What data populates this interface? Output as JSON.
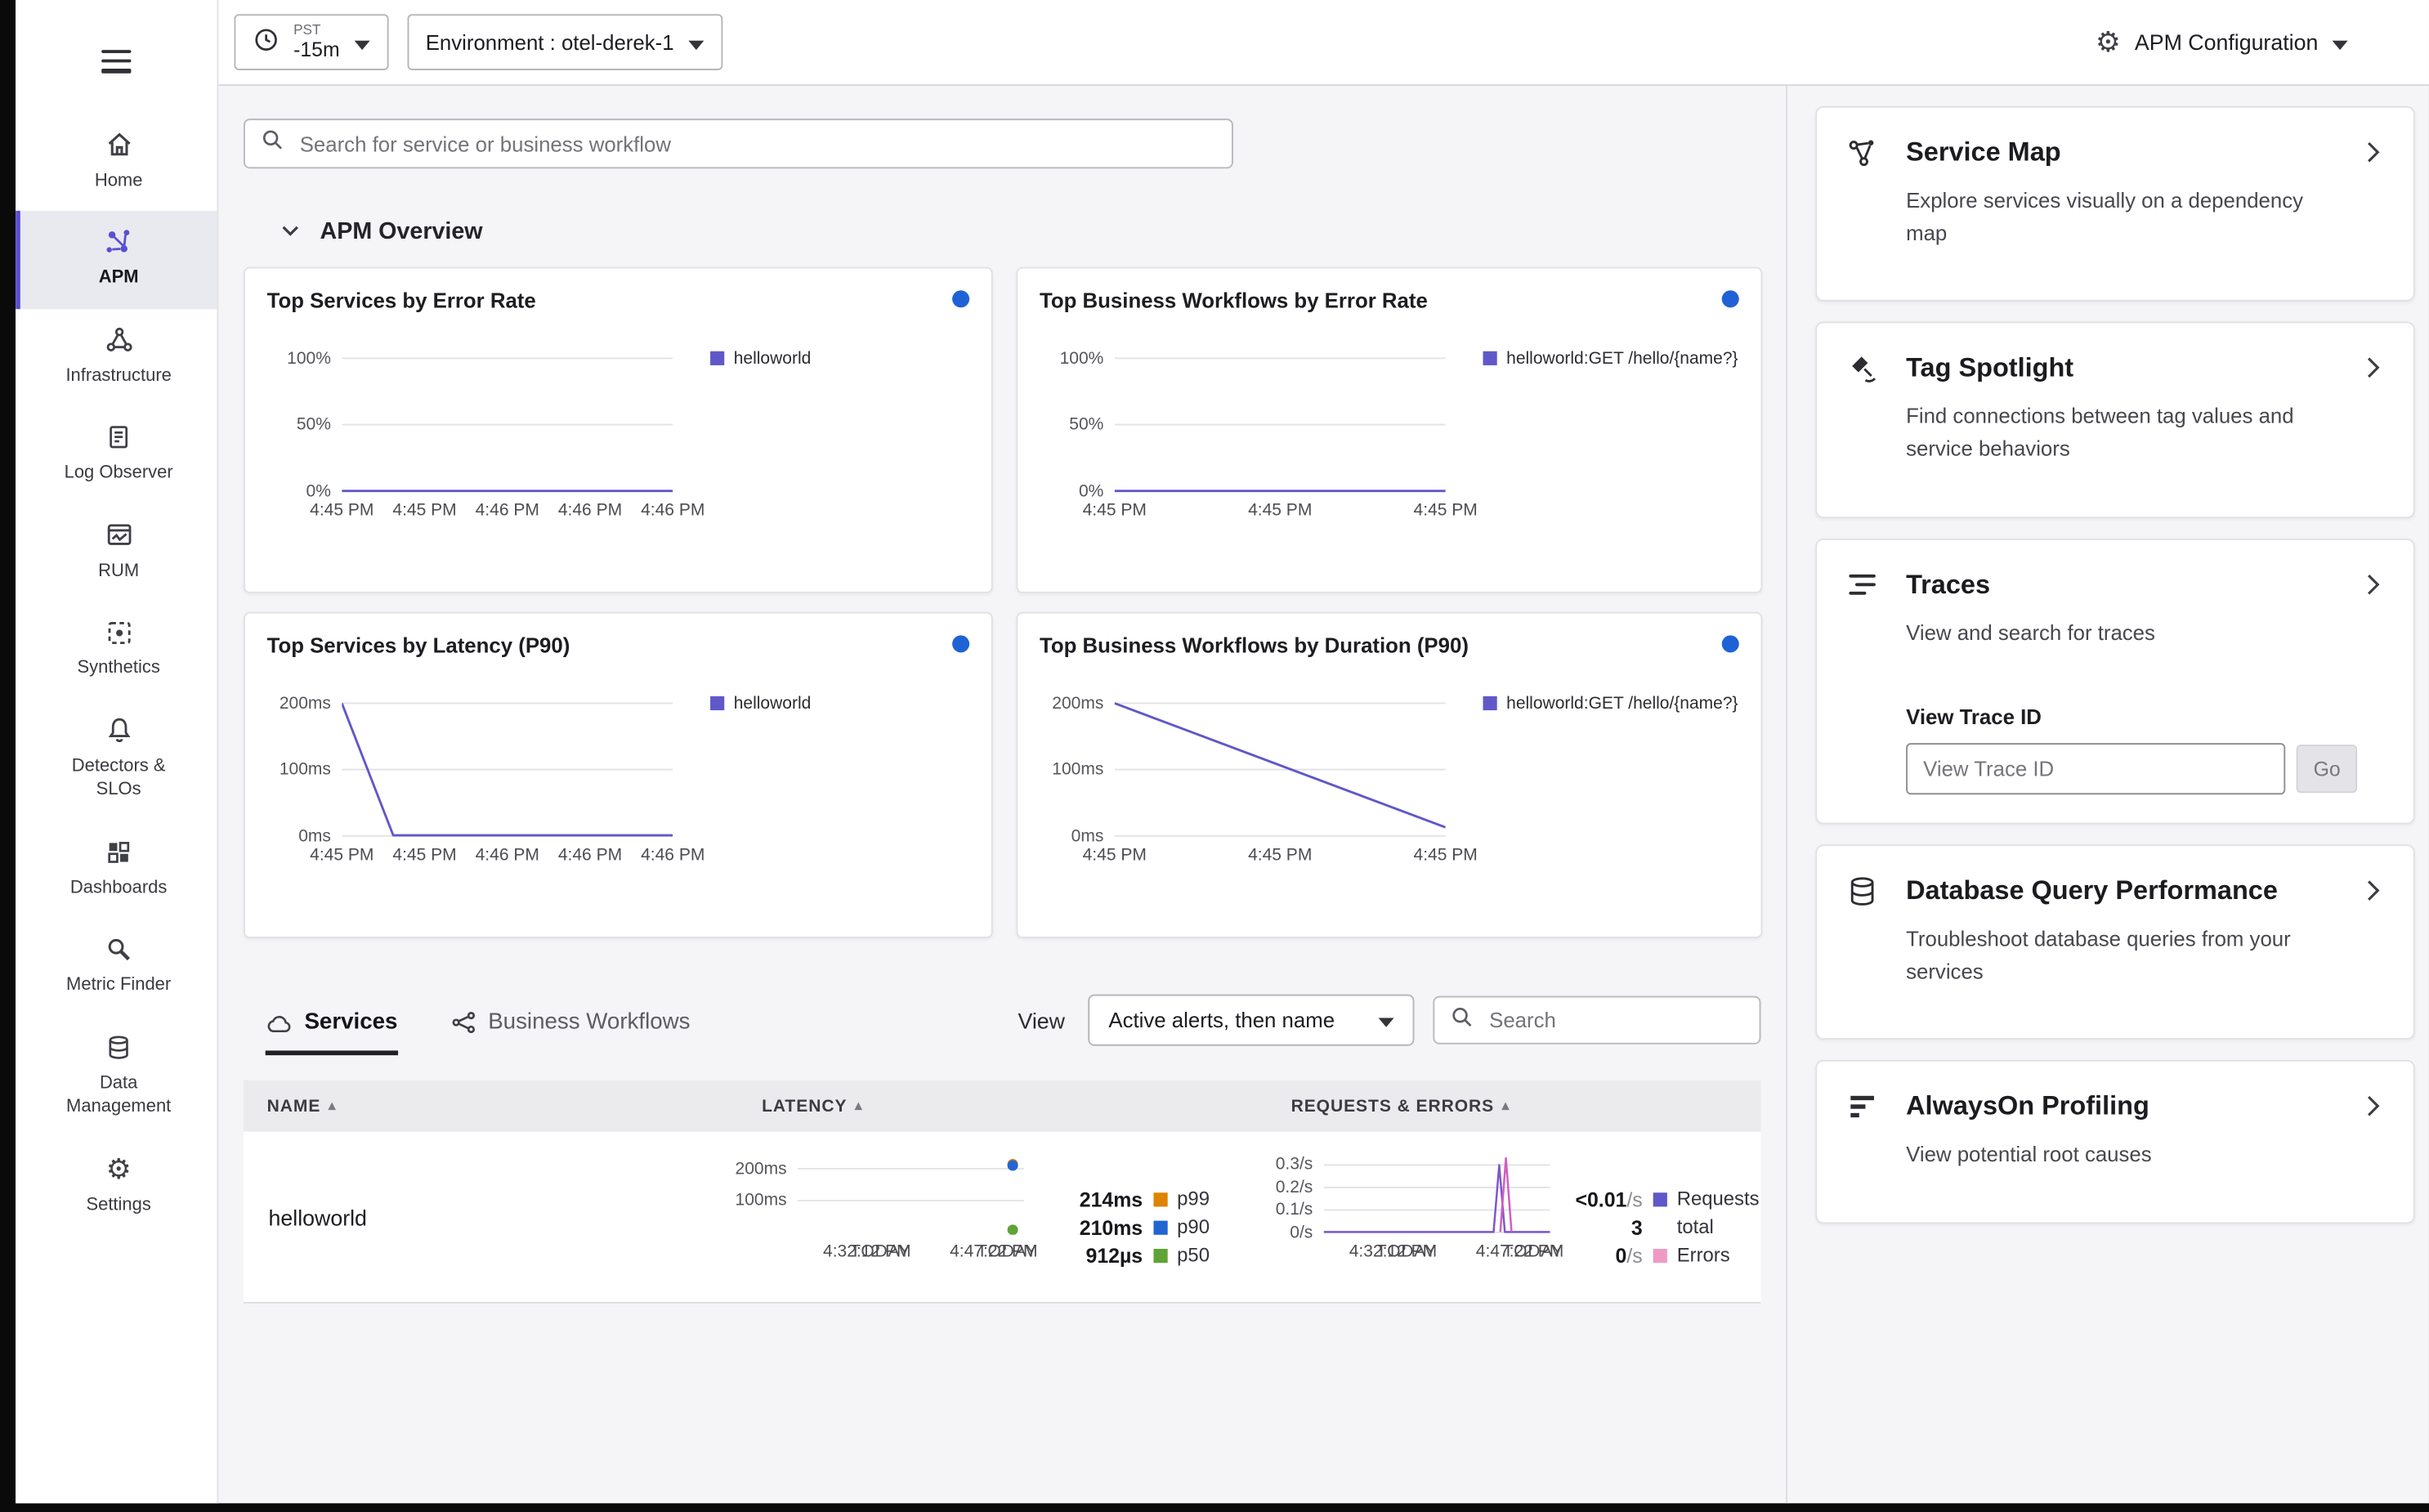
{
  "colors": {
    "accent_purple": "#5a4fcf",
    "status_blue": "#1f62d6",
    "p99_orange": "#dd8400",
    "p90_blue": "#2265d2",
    "p50_green": "#60a336",
    "errors_pink": "#ef9ac4"
  },
  "topbar": {
    "time": {
      "tz": "PST",
      "range": "-15m"
    },
    "environment_label": "Environment : otel-derek-1",
    "config_label": "APM Configuration"
  },
  "sidebar": {
    "items": [
      {
        "label": "Home"
      },
      {
        "label": "APM",
        "selected": true
      },
      {
        "label": "Infrastructure"
      },
      {
        "label": "Log Observer"
      },
      {
        "label": "RUM"
      },
      {
        "label": "Synthetics"
      },
      {
        "label": "Detectors & SLOs"
      },
      {
        "label": "Dashboards"
      },
      {
        "label": "Metric Finder"
      },
      {
        "label": "Data Management"
      },
      {
        "label": "Settings"
      }
    ]
  },
  "main": {
    "search_placeholder": "Search for service or business workflow",
    "overview_title": "APM Overview",
    "tabs": [
      {
        "label": "Services",
        "active": true
      },
      {
        "label": "Business Workflows",
        "active": false
      }
    ],
    "view_label": "View",
    "view_value": "Active alerts, then name",
    "table_search_placeholder": "Search",
    "table": {
      "columns": [
        "NAME",
        "LATENCY",
        "REQUESTS & ERRORS"
      ],
      "row": {
        "name": "helloworld",
        "latency_metrics": [
          {
            "value": "214ms",
            "suffix": "",
            "square": "#dd8400",
            "label": "p99"
          },
          {
            "value": "210ms",
            "suffix": "",
            "square": "#2265d2",
            "label": "p90"
          },
          {
            "value": "912µs",
            "suffix": "",
            "square": "#60a336",
            "label": "p50"
          }
        ],
        "request_metrics": [
          {
            "value": "<0.01",
            "suffix": "/s",
            "square": "#6058c8",
            "label": "Requests"
          },
          {
            "value": "3",
            "suffix": "",
            "square": "",
            "label": "total"
          },
          {
            "value": "0",
            "suffix": "/s",
            "square": "#ef9ac4",
            "label": "Errors"
          }
        ]
      }
    }
  },
  "right_panel": {
    "cards": [
      {
        "title": "Service Map",
        "description": "Explore services visually on a dependency map"
      },
      {
        "title": "Tag Spotlight",
        "description": "Find connections between tag values and service behaviors"
      },
      {
        "title": "Traces",
        "description": "View and search for traces",
        "trace_label": "View Trace ID",
        "trace_placeholder": "View Trace ID",
        "go_label": "Go"
      },
      {
        "title": "Database Query Performance",
        "description": "Troubleshoot database queries from your services"
      },
      {
        "title": "AlwaysOn Profiling",
        "description": "View potential root causes"
      }
    ]
  },
  "chart_data": [
    {
      "id": "top-services-by-error-rate",
      "type": "line",
      "title": "Top Services by Error Rate",
      "status_dot": "#1f62d6",
      "ylim": [
        0,
        100
      ],
      "ylabels": [
        {
          "label": "100%",
          "v": 100
        },
        {
          "label": "50%",
          "v": 50
        },
        {
          "label": "0%",
          "v": 0
        }
      ],
      "xlabels": [
        {
          "text": "4:45 PM",
          "fx": 0
        },
        {
          "text": "4:45 PM",
          "fx": 0.25
        },
        {
          "text": "4:46 PM",
          "fx": 0.5
        },
        {
          "text": "4:46 PM",
          "fx": 0.75
        },
        {
          "text": "4:46 PM",
          "fx": 1
        }
      ],
      "series": [
        {
          "name": "helloworld",
          "color": "#6058c8",
          "points": [
            [
              0,
              0
            ],
            [
              1,
              0
            ]
          ]
        }
      ]
    },
    {
      "id": "top-business-workflows-by-error-rate",
      "type": "line",
      "title": "Top Business Workflows by Error Rate",
      "status_dot": "#1f62d6",
      "ylim": [
        0,
        100
      ],
      "ylabels": [
        {
          "label": "100%",
          "v": 100
        },
        {
          "label": "50%",
          "v": 50
        },
        {
          "label": "0%",
          "v": 0
        }
      ],
      "xlabels": [
        {
          "text": "4:45 PM",
          "fx": 0
        },
        {
          "text": "4:45 PM",
          "fx": 0.5
        },
        {
          "text": "4:45 PM",
          "fx": 1
        }
      ],
      "series": [
        {
          "name": "helloworld:GET /hello/{name?}",
          "color": "#6058c8",
          "points": [
            [
              0,
              0
            ],
            [
              1,
              0
            ]
          ]
        }
      ]
    },
    {
      "id": "top-services-by-latency-p90",
      "type": "line",
      "title": "Top Services by Latency (P90)",
      "status_dot": "#1f62d6",
      "ylim": [
        0,
        200
      ],
      "ylabels": [
        {
          "label": "200ms",
          "v": 200
        },
        {
          "label": "100ms",
          "v": 100
        },
        {
          "label": "0ms",
          "v": 0
        }
      ],
      "xlabels": [
        {
          "text": "4:45 PM",
          "fx": 0
        },
        {
          "text": "4:45 PM",
          "fx": 0.25
        },
        {
          "text": "4:46 PM",
          "fx": 0.5
        },
        {
          "text": "4:46 PM",
          "fx": 0.75
        },
        {
          "text": "4:46 PM",
          "fx": 1
        }
      ],
      "series": [
        {
          "name": "helloworld",
          "color": "#6058c8",
          "points": [
            [
              0,
              200
            ],
            [
              0.155,
              1
            ],
            [
              1,
              1
            ]
          ]
        }
      ]
    },
    {
      "id": "top-business-workflows-by-duration-p90",
      "type": "line",
      "title": "Top Business Workflows by Duration (P90)",
      "status_dot": "#1f62d6",
      "ylim": [
        0,
        200
      ],
      "ylabels": [
        {
          "label": "200ms",
          "v": 200
        },
        {
          "label": "100ms",
          "v": 100
        },
        {
          "label": "0ms",
          "v": 0
        }
      ],
      "xlabels": [
        {
          "text": "4:45 PM",
          "fx": 0
        },
        {
          "text": "4:45 PM",
          "fx": 0.5
        },
        {
          "text": "4:45 PM",
          "fx": 1
        }
      ],
      "series": [
        {
          "name": "helloworld:GET /hello/{name?}",
          "color": "#6058c8",
          "points": [
            [
              0,
              200
            ],
            [
              1,
              13
            ]
          ]
        }
      ]
    },
    {
      "id": "helloworld-latency-sparkline",
      "type": "scatter",
      "ylim": [
        0,
        240
      ],
      "ylabels": [
        {
          "label": "200ms",
          "v": 200
        },
        {
          "label": "100ms",
          "v": 100
        }
      ],
      "xlabels": [
        {
          "text": "4:32:12 PM",
          "sub": "TODAY",
          "fx": 0.5,
          "anchor": "end"
        },
        {
          "text": "4:47:22 PM",
          "sub": "TODAY",
          "fx": 1.06,
          "anchor": "end"
        }
      ],
      "dots": [
        {
          "fx": 0.95,
          "v": 214,
          "color": "#dd8400"
        },
        {
          "fx": 0.95,
          "v": 210,
          "color": "#2265d2"
        },
        {
          "fx": 0.95,
          "v": 8,
          "color": "#60a336"
        }
      ]
    },
    {
      "id": "helloworld-requests-sparkline",
      "type": "line",
      "ylim": [
        0,
        0.34
      ],
      "ylabels": [
        {
          "label": "0.3/s",
          "v": 0.3
        },
        {
          "label": "0.2/s",
          "v": 0.2
        },
        {
          "label": "0.1/s",
          "v": 0.1
        },
        {
          "label": "0/s",
          "v": 0
        }
      ],
      "xlabels": [
        {
          "text": "4:32:12 PM",
          "sub": "TODAY",
          "fx": 0.5,
          "anchor": "end"
        },
        {
          "text": "4:47:22 PM",
          "sub": "TODAY",
          "fx": 1.06,
          "anchor": "end"
        }
      ],
      "series": [
        {
          "name": "Requests",
          "color": "#7e57cc",
          "width": 1.3,
          "points": [
            [
              0,
              0.002
            ],
            [
              0.75,
              0.002
            ],
            [
              0.775,
              0.3
            ],
            [
              0.8,
              0.002
            ],
            [
              1,
              0.002
            ]
          ]
        },
        {
          "name": "Requests spike",
          "color": "#cf5fc0",
          "width": 1.3,
          "points": [
            [
              0.78,
              0.002
            ],
            [
              0.805,
              0.33
            ],
            [
              0.83,
              0.002
            ]
          ]
        }
      ]
    }
  ]
}
